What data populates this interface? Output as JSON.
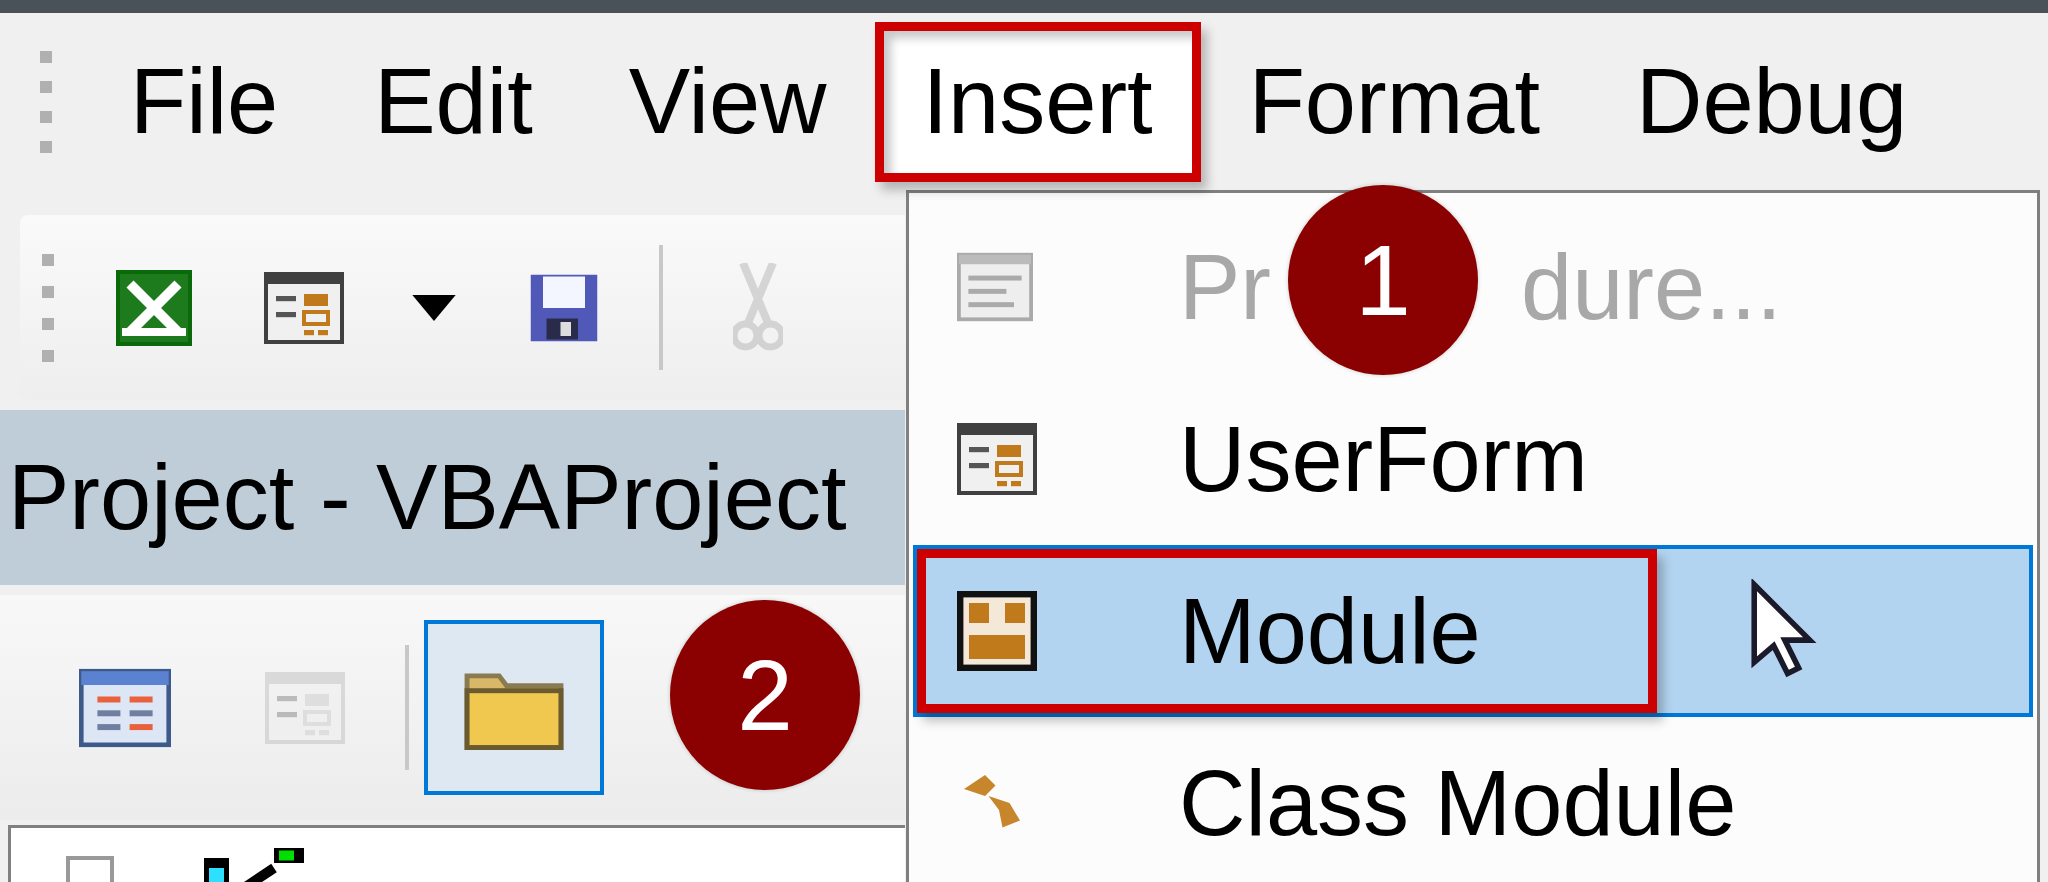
{
  "menubar": [
    {
      "label": "File",
      "selected": false
    },
    {
      "label": "Edit",
      "selected": false
    },
    {
      "label": "View",
      "selected": false
    },
    {
      "label": "Insert",
      "selected": true,
      "annotated": true,
      "callout": "1",
      "submenu": [
        {
          "label_parts": [
            "Pr",
            "dure..."
          ],
          "disabled": true,
          "selected": false
        },
        {
          "label_parts": [
            "UserForm"
          ],
          "disabled": false,
          "selected": false
        },
        {
          "label_parts": [
            "Module"
          ],
          "disabled": false,
          "selected": true,
          "annotated": true
        },
        {
          "label_parts": [
            "Class Module"
          ],
          "disabled": false,
          "selected": false
        }
      ]
    },
    {
      "label": "Format",
      "selected": false
    },
    {
      "label": "Debug",
      "selected": false
    }
  ],
  "toolbar": [
    {
      "kind": "button",
      "disabled": false
    },
    {
      "kind": "button",
      "disabled": false
    },
    {
      "kind": "dropdown",
      "disabled": false
    },
    {
      "kind": "button",
      "disabled": false
    },
    {
      "kind": "separator"
    },
    {
      "kind": "button",
      "disabled": true
    }
  ],
  "project_panel": {
    "title": "Project - VBAProject",
    "toolbar": [
      {
        "kind": "button",
        "disabled": false,
        "selected": false
      },
      {
        "kind": "button",
        "disabled": true,
        "selected": false
      },
      {
        "kind": "separator"
      },
      {
        "kind": "toggle",
        "disabled": false,
        "selected": true,
        "callout": "2"
      }
    ]
  }
}
